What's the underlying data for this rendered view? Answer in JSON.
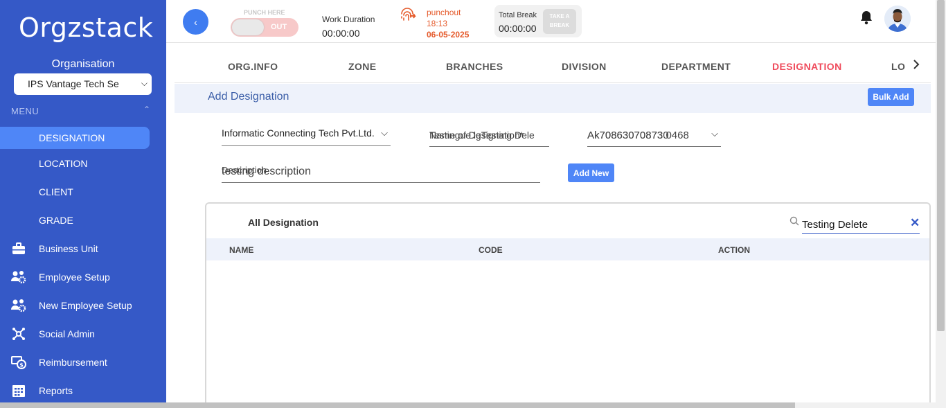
{
  "sidebar": {
    "logo": "Orgzstack",
    "organisation_label": "Organisation",
    "organisation_value": "IPS Vantage Tech Se",
    "menu_label": "MENU",
    "items": [
      {
        "label": "DESIGNATION",
        "icon": "none",
        "active": true
      },
      {
        "label": "LOCATION",
        "icon": "none"
      },
      {
        "label": "CLIENT",
        "icon": "none"
      },
      {
        "label": "GRADE",
        "icon": "none"
      },
      {
        "label": "Business Unit",
        "icon": "briefcase-icon"
      },
      {
        "label": "Employee Setup",
        "icon": "users-gear-icon"
      },
      {
        "label": "New Employee Setup",
        "icon": "users-gear-icon"
      },
      {
        "label": "Social Admin",
        "icon": "network-icon"
      },
      {
        "label": "Reimbursement",
        "icon": "money-refresh-icon"
      },
      {
        "label": "Reports",
        "icon": "calendar-grid-icon"
      }
    ]
  },
  "topbar": {
    "back_label": "‹",
    "punch_here": "PUNCH HERE",
    "punch_state": "OUT",
    "work_duration_label": "Work Duration",
    "work_duration_value": "00:00:00",
    "punchout_label": "punchout",
    "punchout_time": "18:13",
    "punchout_date": "06-05-2025",
    "total_break_label": "Total Break",
    "total_break_value": "00:00:00",
    "take_break_line1": "TAKE A",
    "take_break_line2": "BREAK"
  },
  "tabs": [
    "ORG.INFO",
    "ZONE",
    "BRANCHES",
    "DIVISION",
    "DEPARTMENT",
    "DESIGNATION",
    "LO"
  ],
  "active_tab": "DESIGNATION",
  "section": {
    "title": "Add Designation",
    "bulk_add": "Bulk Add"
  },
  "form": {
    "company_value": "Informatic Connecting Tech Pvt.Ltd.",
    "name_overlap_a": "Name of Designation*",
    "name_value": "Testingue.lgTesting Dele",
    "code_overlap": "Ak708630708730",
    "code_value": "Ak70863070873 0468",
    "description_placeholder": "Description",
    "description_value": "testing description",
    "add_new": "Add New"
  },
  "table": {
    "title": "All Designation",
    "search_value": "Testing Delete",
    "clear": "✕",
    "columns": [
      "NAME",
      "CODE",
      "ACTION"
    ]
  },
  "colors": {
    "sidebar": "#3559c7",
    "accent": "#4f86f7",
    "active_tab": "#ef4b5c",
    "punchout": "#e55a2b"
  }
}
